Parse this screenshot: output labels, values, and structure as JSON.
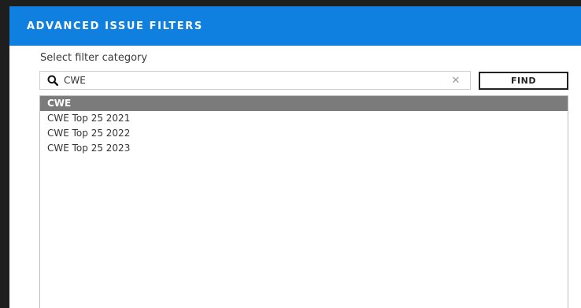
{
  "dialog": {
    "title": "ADVANCED ISSUE FILTERS",
    "header_color": "#0f7fe0"
  },
  "filter": {
    "section_label": "Select filter category",
    "search_value": "CWE",
    "search_icon": "search-icon",
    "clear_icon": "close-icon",
    "find_label": "FIND"
  },
  "results": {
    "selected_color": "#7b7b7b",
    "items": [
      {
        "label": "CWE",
        "selected": true
      },
      {
        "label": "CWE Top 25 2021",
        "selected": false
      },
      {
        "label": "CWE Top 25 2022",
        "selected": false
      },
      {
        "label": "CWE Top 25 2023",
        "selected": false
      }
    ]
  }
}
